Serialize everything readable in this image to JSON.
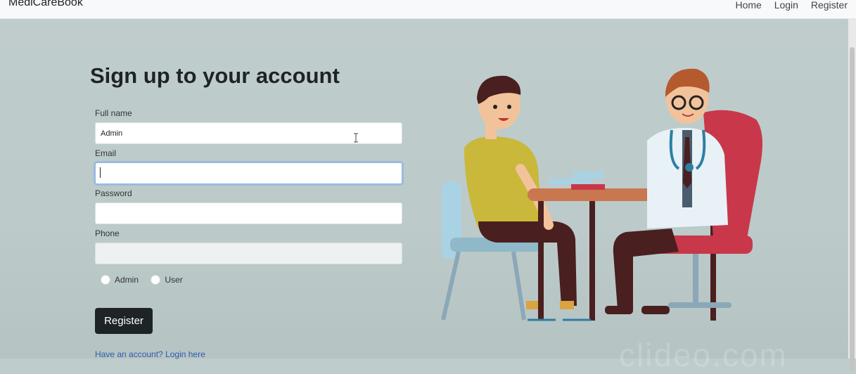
{
  "navbar": {
    "brand": "MediCareBook",
    "links": [
      "Home",
      "Login",
      "Register"
    ]
  },
  "form": {
    "title": "Sign up to your account",
    "fields": [
      {
        "label": "Full name",
        "value": "Admin"
      },
      {
        "label": "Email",
        "value": ""
      },
      {
        "label": "Password",
        "value": ""
      },
      {
        "label": "Phone",
        "value": ""
      }
    ],
    "roles": [
      "Admin",
      "User"
    ],
    "submit_label": "Register",
    "login_link": "Have an account? Login here"
  },
  "watermark": "clideo.com",
  "icons": [
    "text-cursor-icon",
    "radio-icon"
  ],
  "colors": {
    "background": "#bfcccc",
    "button": "#1e2326",
    "link": "#2a5db0"
  }
}
